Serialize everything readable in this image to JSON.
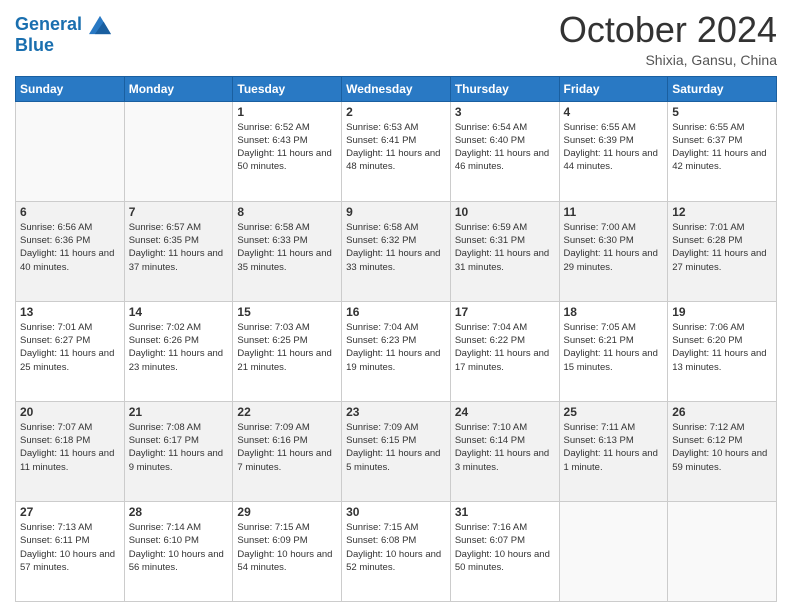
{
  "header": {
    "logo_line1": "General",
    "logo_line2": "Blue",
    "month": "October 2024",
    "location": "Shixia, Gansu, China"
  },
  "weekdays": [
    "Sunday",
    "Monday",
    "Tuesday",
    "Wednesday",
    "Thursday",
    "Friday",
    "Saturday"
  ],
  "weeks": [
    [
      {
        "day": "",
        "sunrise": "",
        "sunset": "",
        "daylight": ""
      },
      {
        "day": "",
        "sunrise": "",
        "sunset": "",
        "daylight": ""
      },
      {
        "day": "1",
        "sunrise": "Sunrise: 6:52 AM",
        "sunset": "Sunset: 6:43 PM",
        "daylight": "Daylight: 11 hours and 50 minutes."
      },
      {
        "day": "2",
        "sunrise": "Sunrise: 6:53 AM",
        "sunset": "Sunset: 6:41 PM",
        "daylight": "Daylight: 11 hours and 48 minutes."
      },
      {
        "day": "3",
        "sunrise": "Sunrise: 6:54 AM",
        "sunset": "Sunset: 6:40 PM",
        "daylight": "Daylight: 11 hours and 46 minutes."
      },
      {
        "day": "4",
        "sunrise": "Sunrise: 6:55 AM",
        "sunset": "Sunset: 6:39 PM",
        "daylight": "Daylight: 11 hours and 44 minutes."
      },
      {
        "day": "5",
        "sunrise": "Sunrise: 6:55 AM",
        "sunset": "Sunset: 6:37 PM",
        "daylight": "Daylight: 11 hours and 42 minutes."
      }
    ],
    [
      {
        "day": "6",
        "sunrise": "Sunrise: 6:56 AM",
        "sunset": "Sunset: 6:36 PM",
        "daylight": "Daylight: 11 hours and 40 minutes."
      },
      {
        "day": "7",
        "sunrise": "Sunrise: 6:57 AM",
        "sunset": "Sunset: 6:35 PM",
        "daylight": "Daylight: 11 hours and 37 minutes."
      },
      {
        "day": "8",
        "sunrise": "Sunrise: 6:58 AM",
        "sunset": "Sunset: 6:33 PM",
        "daylight": "Daylight: 11 hours and 35 minutes."
      },
      {
        "day": "9",
        "sunrise": "Sunrise: 6:58 AM",
        "sunset": "Sunset: 6:32 PM",
        "daylight": "Daylight: 11 hours and 33 minutes."
      },
      {
        "day": "10",
        "sunrise": "Sunrise: 6:59 AM",
        "sunset": "Sunset: 6:31 PM",
        "daylight": "Daylight: 11 hours and 31 minutes."
      },
      {
        "day": "11",
        "sunrise": "Sunrise: 7:00 AM",
        "sunset": "Sunset: 6:30 PM",
        "daylight": "Daylight: 11 hours and 29 minutes."
      },
      {
        "day": "12",
        "sunrise": "Sunrise: 7:01 AM",
        "sunset": "Sunset: 6:28 PM",
        "daylight": "Daylight: 11 hours and 27 minutes."
      }
    ],
    [
      {
        "day": "13",
        "sunrise": "Sunrise: 7:01 AM",
        "sunset": "Sunset: 6:27 PM",
        "daylight": "Daylight: 11 hours and 25 minutes."
      },
      {
        "day": "14",
        "sunrise": "Sunrise: 7:02 AM",
        "sunset": "Sunset: 6:26 PM",
        "daylight": "Daylight: 11 hours and 23 minutes."
      },
      {
        "day": "15",
        "sunrise": "Sunrise: 7:03 AM",
        "sunset": "Sunset: 6:25 PM",
        "daylight": "Daylight: 11 hours and 21 minutes."
      },
      {
        "day": "16",
        "sunrise": "Sunrise: 7:04 AM",
        "sunset": "Sunset: 6:23 PM",
        "daylight": "Daylight: 11 hours and 19 minutes."
      },
      {
        "day": "17",
        "sunrise": "Sunrise: 7:04 AM",
        "sunset": "Sunset: 6:22 PM",
        "daylight": "Daylight: 11 hours and 17 minutes."
      },
      {
        "day": "18",
        "sunrise": "Sunrise: 7:05 AM",
        "sunset": "Sunset: 6:21 PM",
        "daylight": "Daylight: 11 hours and 15 minutes."
      },
      {
        "day": "19",
        "sunrise": "Sunrise: 7:06 AM",
        "sunset": "Sunset: 6:20 PM",
        "daylight": "Daylight: 11 hours and 13 minutes."
      }
    ],
    [
      {
        "day": "20",
        "sunrise": "Sunrise: 7:07 AM",
        "sunset": "Sunset: 6:18 PM",
        "daylight": "Daylight: 11 hours and 11 minutes."
      },
      {
        "day": "21",
        "sunrise": "Sunrise: 7:08 AM",
        "sunset": "Sunset: 6:17 PM",
        "daylight": "Daylight: 11 hours and 9 minutes."
      },
      {
        "day": "22",
        "sunrise": "Sunrise: 7:09 AM",
        "sunset": "Sunset: 6:16 PM",
        "daylight": "Daylight: 11 hours and 7 minutes."
      },
      {
        "day": "23",
        "sunrise": "Sunrise: 7:09 AM",
        "sunset": "Sunset: 6:15 PM",
        "daylight": "Daylight: 11 hours and 5 minutes."
      },
      {
        "day": "24",
        "sunrise": "Sunrise: 7:10 AM",
        "sunset": "Sunset: 6:14 PM",
        "daylight": "Daylight: 11 hours and 3 minutes."
      },
      {
        "day": "25",
        "sunrise": "Sunrise: 7:11 AM",
        "sunset": "Sunset: 6:13 PM",
        "daylight": "Daylight: 11 hours and 1 minute."
      },
      {
        "day": "26",
        "sunrise": "Sunrise: 7:12 AM",
        "sunset": "Sunset: 6:12 PM",
        "daylight": "Daylight: 10 hours and 59 minutes."
      }
    ],
    [
      {
        "day": "27",
        "sunrise": "Sunrise: 7:13 AM",
        "sunset": "Sunset: 6:11 PM",
        "daylight": "Daylight: 10 hours and 57 minutes."
      },
      {
        "day": "28",
        "sunrise": "Sunrise: 7:14 AM",
        "sunset": "Sunset: 6:10 PM",
        "daylight": "Daylight: 10 hours and 56 minutes."
      },
      {
        "day": "29",
        "sunrise": "Sunrise: 7:15 AM",
        "sunset": "Sunset: 6:09 PM",
        "daylight": "Daylight: 10 hours and 54 minutes."
      },
      {
        "day": "30",
        "sunrise": "Sunrise: 7:15 AM",
        "sunset": "Sunset: 6:08 PM",
        "daylight": "Daylight: 10 hours and 52 minutes."
      },
      {
        "day": "31",
        "sunrise": "Sunrise: 7:16 AM",
        "sunset": "Sunset: 6:07 PM",
        "daylight": "Daylight: 10 hours and 50 minutes."
      },
      {
        "day": "",
        "sunrise": "",
        "sunset": "",
        "daylight": ""
      },
      {
        "day": "",
        "sunrise": "",
        "sunset": "",
        "daylight": ""
      }
    ]
  ]
}
